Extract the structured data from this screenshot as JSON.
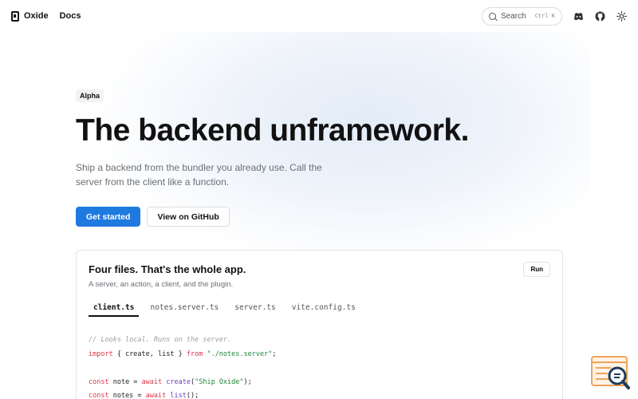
{
  "header": {
    "brand": "Oxide",
    "nav_docs": "Docs",
    "search_label": "Search",
    "search_shortcut": "Ctrl K",
    "icons": [
      "discord-icon",
      "github-icon",
      "theme-toggle-icon"
    ]
  },
  "hero": {
    "badge": "Alpha",
    "headline": "The backend unframework.",
    "subtitle": "Ship a backend from the bundler you already use. Call the server from the client like a function.",
    "primary_cta": "Get started",
    "secondary_cta": "View on GitHub"
  },
  "card": {
    "title": "Four files. That's the whole app.",
    "subtitle": "A server, an action, a client, and the plugin.",
    "run_label": "Run",
    "tabs": [
      "client.ts",
      "notes.server.ts",
      "server.ts",
      "vite.config.ts"
    ],
    "active_tab": "client.ts",
    "code": {
      "comment": "// Looks local. Runs on the server.",
      "line2_kw1": "import",
      "line2_mid": " { create, list } ",
      "line2_kw2": "from",
      "line2_str": "\"./notes.server\"",
      "line2_end": ";",
      "line4_kw1": "const",
      "line4_mid": " note = ",
      "line4_kw2": "await",
      "line4_fn": "create",
      "line4_str": "\"Ship Oxide\"",
      "line5_kw1": "const",
      "line5_mid": " notes = ",
      "line5_kw2": "await",
      "line5_fn": "list"
    }
  },
  "colors": {
    "accent": "#1f7ae0",
    "keyword": "#d73a49",
    "function": "#6f42c1",
    "string": "#22863a",
    "comment": "#9aa0a6"
  }
}
